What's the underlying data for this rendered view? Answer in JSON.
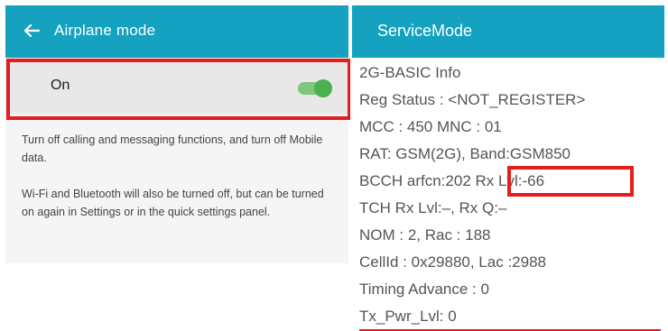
{
  "airplane": {
    "title": "Airplane mode",
    "back_icon": "arrow-back-icon",
    "toggle_label": "On",
    "toggle_state": true,
    "description_1": "Turn off calling and messaging functions, and turn off Mobile data.",
    "description_2": "Wi-Fi and Bluetooth will also be turned off, but can be turned on again in Settings or in the quick settings panel.",
    "colors": {
      "header": "#14a2c0",
      "switch_on": "#4caf50",
      "highlight": "#e41e1e"
    }
  },
  "service": {
    "title": "ServiceMode",
    "lines": [
      "2G-BASIC Info",
      "Reg Status : <NOT_REGISTER>",
      "MCC : 450 MNC : 01",
      "RAT: GSM(2G), Band:GSM850",
      "BCCH arfcn:202",
      "TCH Rx Lvl:–, Rx Q:–",
      "NOM : 2, Rac : 188",
      "CellId : 0x29880, Lac :2988",
      "Timing Advance : 0",
      "Tx_Pwr_Lvl: 0"
    ],
    "rx_lvl": "Rx Lvl:-66"
  }
}
